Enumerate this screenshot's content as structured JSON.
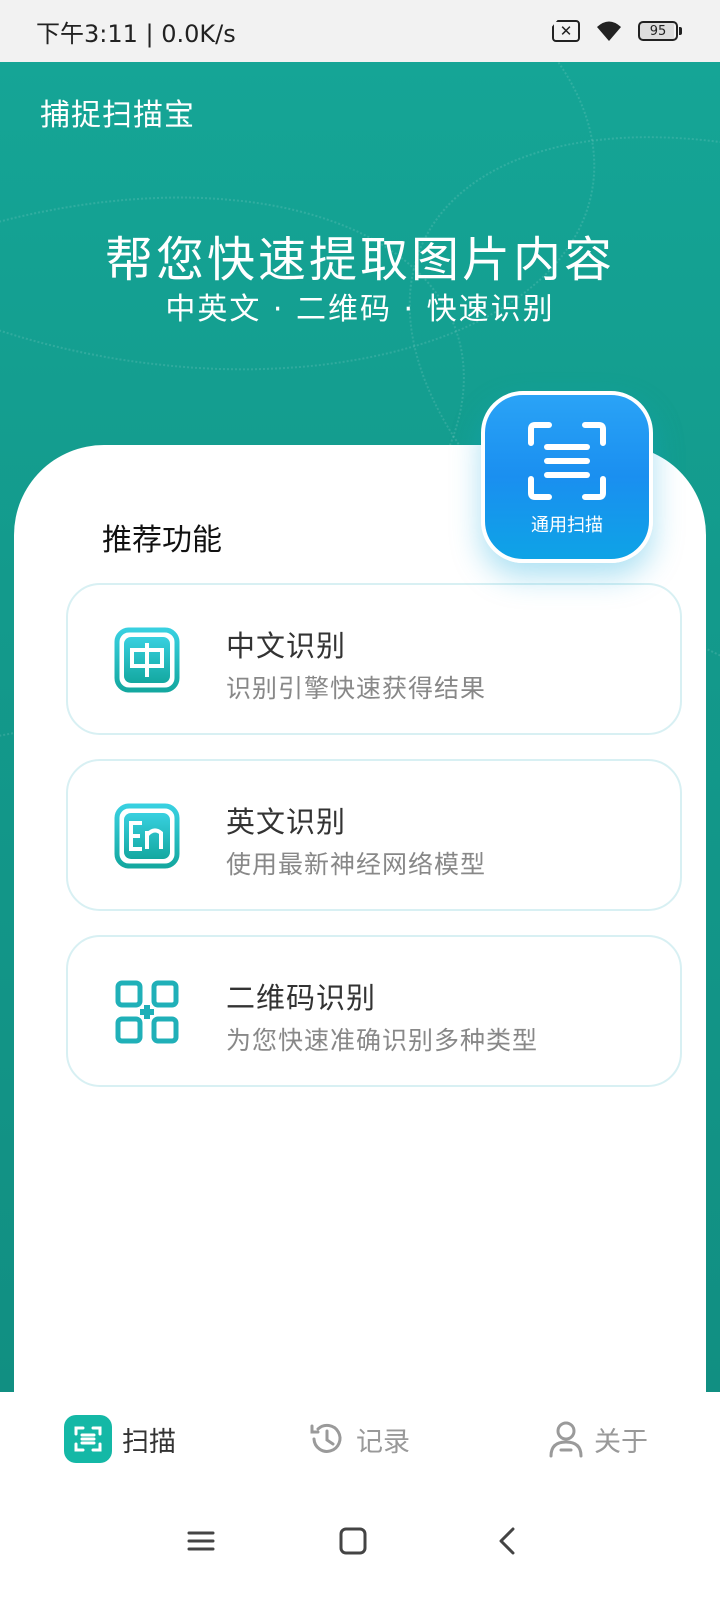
{
  "status_bar": {
    "time_net": "下午3:11 | 0.0K/s",
    "battery": "95"
  },
  "header": {
    "app_title": "捕捉扫描宝",
    "headline": "帮您快速提取图片内容",
    "subheadline": "中英文 · 二维码 · 快速识别"
  },
  "card": {
    "title": "推荐功能",
    "scan_button_label": "通用扫描",
    "features": [
      {
        "name": "中文识别",
        "desc": "识别引擎快速获得结果",
        "icon": "chinese-char-icon"
      },
      {
        "name": "英文识别",
        "desc": "使用最新神经网络模型",
        "icon": "english-en-icon"
      },
      {
        "name": "二维码识别",
        "desc": "为您快速准确识别多种类型",
        "icon": "qr-code-icon"
      }
    ]
  },
  "tabs": [
    {
      "label": "扫描",
      "icon": "scan-icon",
      "active": true
    },
    {
      "label": "记录",
      "icon": "history-icon",
      "active": false
    },
    {
      "label": "关于",
      "icon": "user-icon",
      "active": false
    }
  ],
  "colors": {
    "brand_teal": "#15a596",
    "accent_blue": "#1a8ff0",
    "icon_teal": "#14b8a6"
  }
}
